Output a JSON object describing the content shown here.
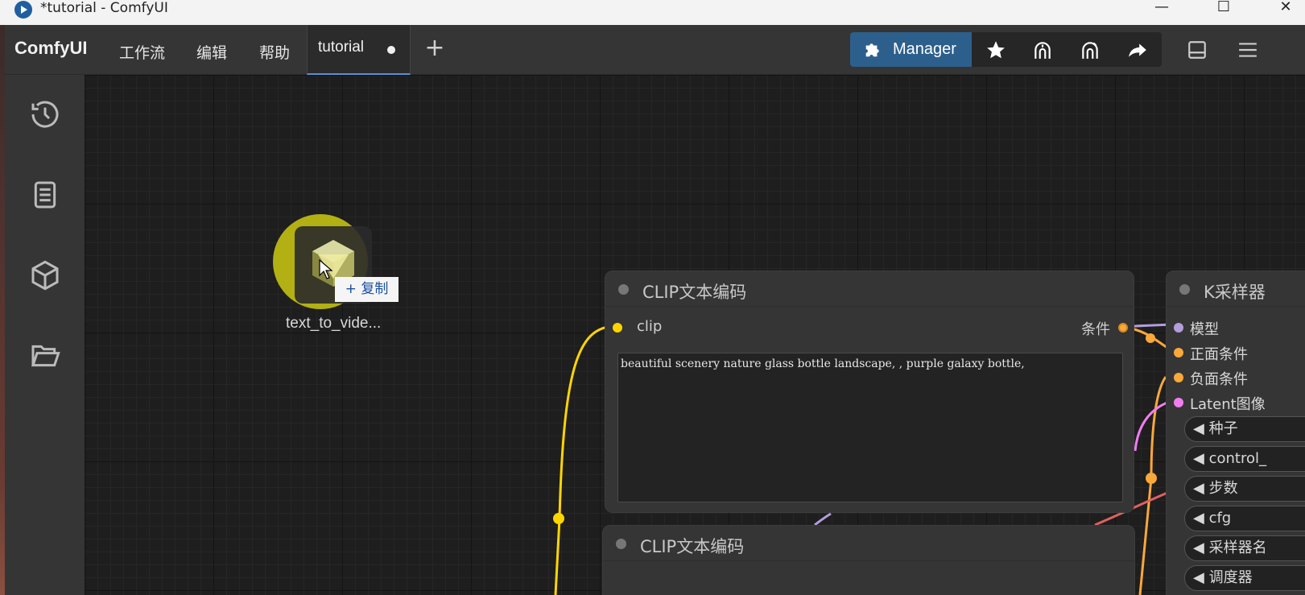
{
  "window": {
    "title": "*tutorial - ComfyUI"
  },
  "menubar": {
    "brand": "ComfyUI",
    "items": [
      "工作流",
      "编辑",
      "帮助"
    ],
    "tab": {
      "label": "tutorial"
    },
    "manager_label": "Manager"
  },
  "canvas": {
    "drag_item": {
      "label": "text_to_vide...",
      "tooltip": "+ 复制"
    },
    "nodes": {
      "clip1": {
        "title": "CLIP文本编码",
        "input": "clip",
        "output": "条件",
        "prompt": "beautiful scenery nature glass bottle landscape, , purple galaxy bottle,"
      },
      "clip2": {
        "title": "CLIP文本编码"
      },
      "ksampler": {
        "title": "K采样器",
        "inputs": [
          {
            "label": "模型",
            "color": "#b39ddb"
          },
          {
            "label": "正面条件",
            "color": "#f9a83a"
          },
          {
            "label": "负面条件",
            "color": "#f9a83a"
          },
          {
            "label": "Latent图像",
            "color": "#f07ef0"
          }
        ],
        "widgets": [
          "◀ 种子",
          "◀ control_",
          "◀ 步数",
          "◀ cfg",
          "◀ 采样器名",
          "◀ 调度器"
        ]
      }
    }
  },
  "colors": {
    "accent": "#2d5f8c",
    "clip_wire": "#ffd500",
    "cond_wire": "#f9a83a",
    "latent_wire": "#f07ef0",
    "model_wire": "#b39ddb"
  }
}
